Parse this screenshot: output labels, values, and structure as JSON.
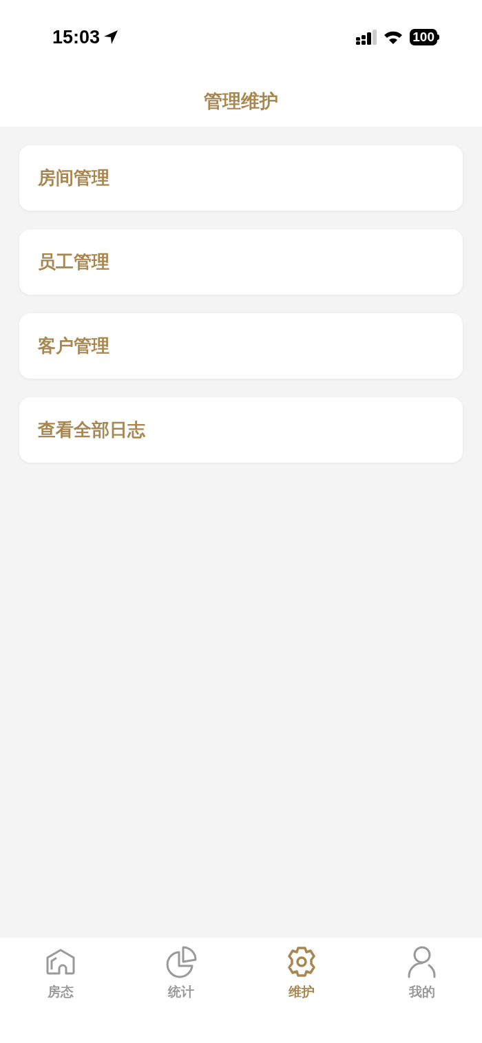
{
  "status_bar": {
    "time": "15:03",
    "battery": "100"
  },
  "header": {
    "title": "管理维护"
  },
  "menu": [
    {
      "label": "房间管理"
    },
    {
      "label": "员工管理"
    },
    {
      "label": "客户管理"
    },
    {
      "label": "查看全部日志"
    }
  ],
  "tab_bar": [
    {
      "label": "房态",
      "selected": false
    },
    {
      "label": "统计",
      "selected": false
    },
    {
      "label": "维护",
      "selected": true
    },
    {
      "label": "我的",
      "selected": false
    }
  ]
}
